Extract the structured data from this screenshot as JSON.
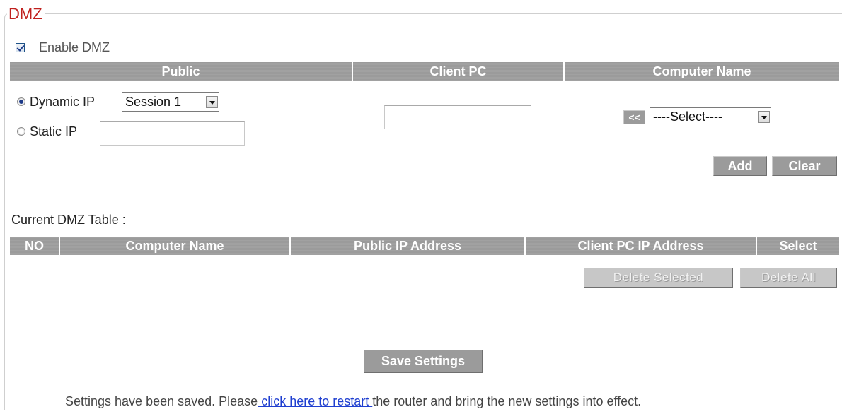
{
  "section": {
    "title": "DMZ"
  },
  "enable": {
    "label": "Enable DMZ",
    "checked": true
  },
  "rules_table": {
    "headers": [
      "Public",
      "Client PC",
      "Computer Name"
    ],
    "dynamic_ip": {
      "label": "Dynamic IP",
      "selected": true,
      "session_select": "Session 1"
    },
    "static_ip": {
      "label": "Static IP",
      "selected": false,
      "value": ""
    },
    "client_pc_value": "",
    "copy_button": "<<",
    "computer_select": "----Select----",
    "add_label": "Add",
    "clear_label": "Clear"
  },
  "current_table": {
    "caption": "Current DMZ Table :",
    "headers": [
      "NO",
      "Computer Name",
      "Public  IP Address",
      "Client PC  IP Address",
      "Select"
    ],
    "rows": [],
    "delete_selected_label": "Delete Selected",
    "delete_all_label": "Delete All"
  },
  "save_label": "Save Settings",
  "footer": {
    "before": "Settings have been saved. Please",
    "link": " click here to restart ",
    "after": "the router and bring the new settings into effect."
  }
}
